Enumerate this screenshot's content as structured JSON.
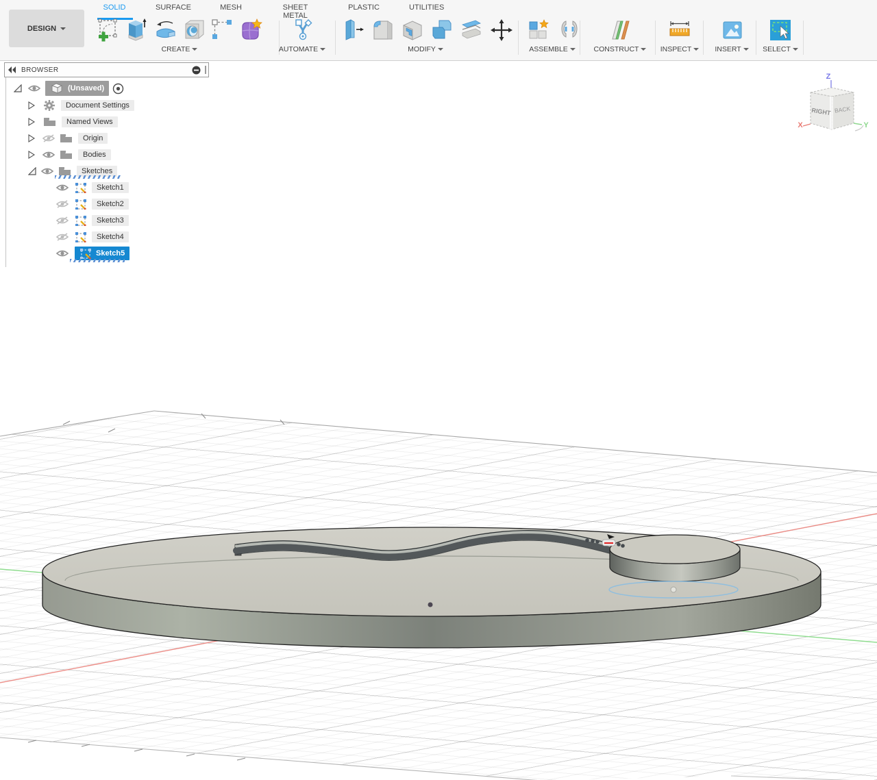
{
  "design_button": {
    "label": "DESIGN"
  },
  "tabs": [
    {
      "label": "SOLID",
      "active": true
    },
    {
      "label": "SURFACE",
      "active": false
    },
    {
      "label": "MESH",
      "active": false
    },
    {
      "label": "SHEET METAL",
      "active": false
    },
    {
      "label": "PLASTIC",
      "active": false
    },
    {
      "label": "UTILITIES",
      "active": false
    }
  ],
  "groups": [
    {
      "label": "CREATE",
      "icons": [
        "create-sketch",
        "extrude",
        "revolve",
        "hole",
        "rectangular-pattern",
        "form"
      ]
    },
    {
      "label": "AUTOMATE",
      "icons": [
        "automate"
      ]
    },
    {
      "label": "MODIFY",
      "icons": [
        "press-pull",
        "fillet",
        "shell",
        "combine",
        "split-body",
        "move-copy"
      ]
    },
    {
      "label": "ASSEMBLE",
      "icons": [
        "new-component",
        "joint"
      ]
    },
    {
      "label": "CONSTRUCT",
      "icons": [
        "offset-plane"
      ]
    },
    {
      "label": "INSPECT",
      "icons": [
        "measure"
      ]
    },
    {
      "label": "INSERT",
      "icons": [
        "insert-image"
      ]
    },
    {
      "label": "SELECT",
      "icons": [
        "select"
      ]
    }
  ],
  "browser": {
    "title": "BROWSER",
    "rows": [
      {
        "label": "(Unsaved)",
        "visible": true,
        "selected": false,
        "expanded": true
      },
      {
        "label": "Document Settings",
        "visible": null,
        "selected": false,
        "expanded": false
      },
      {
        "label": "Named Views",
        "visible": null,
        "selected": false,
        "expanded": false
      },
      {
        "label": "Origin",
        "visible": false,
        "selected": false,
        "expanded": false
      },
      {
        "label": "Bodies",
        "visible": true,
        "selected": false,
        "expanded": false
      },
      {
        "label": "Sketches",
        "visible": true,
        "selected": false,
        "expanded": true
      },
      {
        "label": "Sketch1",
        "visible": true,
        "selected": false
      },
      {
        "label": "Sketch2",
        "visible": false,
        "selected": false
      },
      {
        "label": "Sketch3",
        "visible": false,
        "selected": false
      },
      {
        "label": "Sketch4",
        "visible": false,
        "selected": false
      },
      {
        "label": "Sketch5",
        "visible": true,
        "selected": true
      }
    ]
  },
  "viewcube": {
    "face_left": "RIGHT",
    "face_right": "BACK",
    "axis_x": "X",
    "axis_y": "Y",
    "axis_z": "Z"
  },
  "colors": {
    "accent_blue": "#1a9af0",
    "selection_blue": "#1588d1",
    "axis_red": "#ec8c86",
    "axis_green": "#8edc8e",
    "axis_z_blue": "#7878e8",
    "model_top": "#c9c8bf",
    "sketch_blue": "#90bede"
  }
}
